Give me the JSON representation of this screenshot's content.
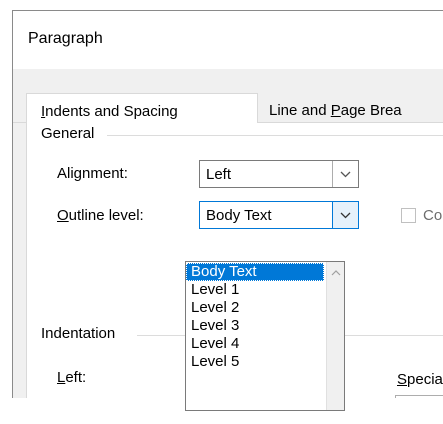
{
  "dialog": {
    "title": "Paragraph",
    "tabs": [
      {
        "label_pre": "",
        "label_key": "I",
        "label_post": "ndents and Spacing",
        "active": true
      },
      {
        "label_pre": "Line and ",
        "label_key": "P",
        "label_post": "age Brea",
        "active": false
      }
    ]
  },
  "general": {
    "section_label": "General",
    "alignment": {
      "label_pre": "Ali",
      "label_key": "g",
      "label_post": "nment:",
      "value": "Left"
    },
    "outline_level": {
      "label_pre": "",
      "label_key": "O",
      "label_post": "utline level:",
      "value": "Body Text"
    },
    "collapsed_checkbox_label": "Col"
  },
  "outline_dropdown": {
    "options": [
      "Body Text",
      "Level 1",
      "Level 2",
      "Level 3",
      "Level 4",
      "Level 5"
    ],
    "selected_index": 0
  },
  "indentation": {
    "section_label": "Indentation",
    "left_label_key": "L",
    "left_label_post": "eft:",
    "special_label_key": "S",
    "special_label_post": "pecia"
  },
  "colors": {
    "accent": "#0078d7",
    "dialog_bg": "#f0f0f0",
    "panel_bg": "#ffffff"
  },
  "icons": {
    "dropdown_button": "chevron-down-icon",
    "scroll_up": "chevron-up-icon"
  }
}
